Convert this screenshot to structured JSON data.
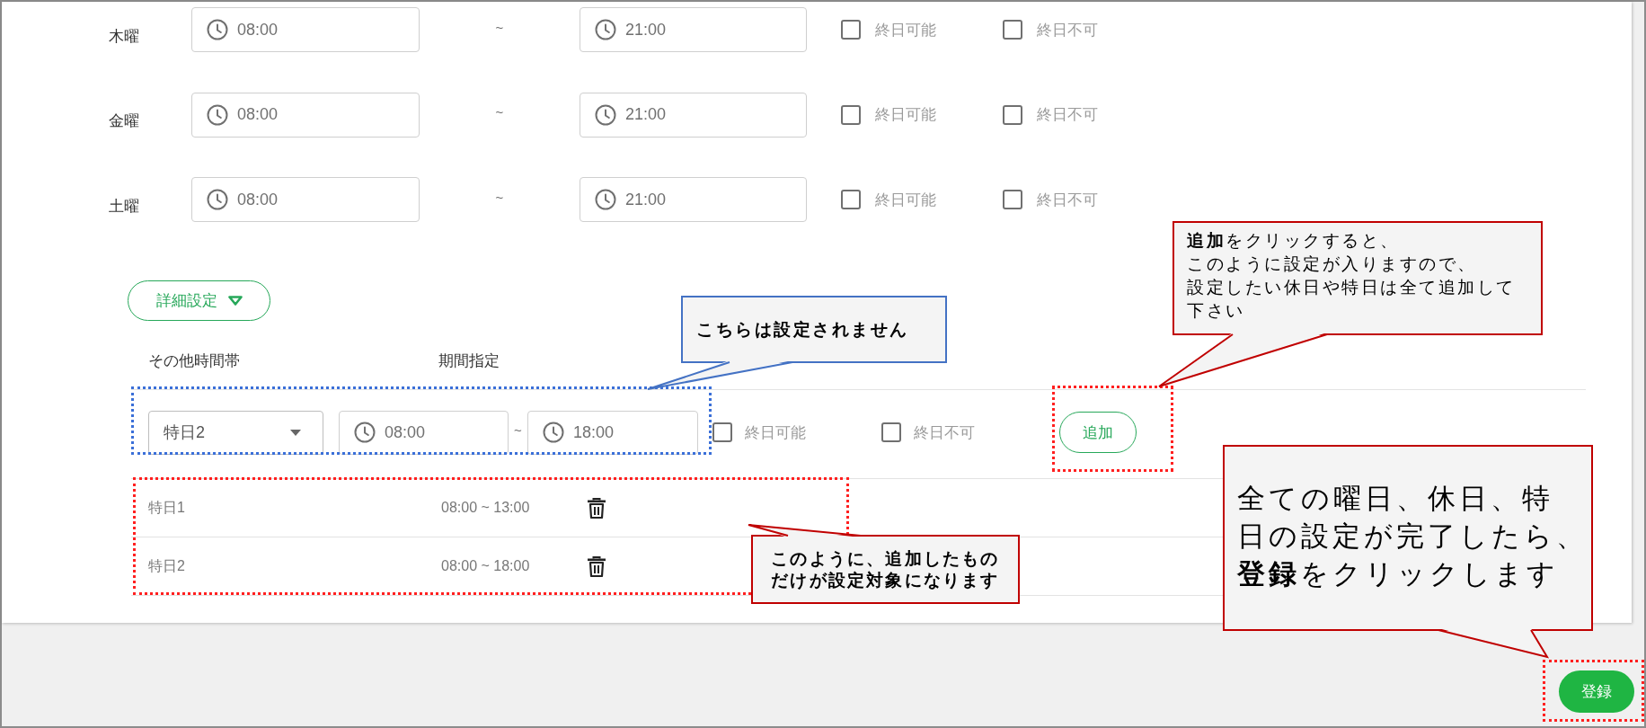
{
  "weekdays": [
    {
      "day": "木曜",
      "start": "08:00",
      "separator": "~",
      "end": "21:00",
      "options": [
        {
          "label": "終日可能",
          "checked": false
        },
        {
          "label": "終日不可",
          "checked": false
        }
      ]
    },
    {
      "day": "金曜",
      "start": "08:00",
      "separator": "~",
      "end": "21:00",
      "options": [
        {
          "label": "終日可能",
          "checked": false
        },
        {
          "label": "終日不可",
          "checked": false
        }
      ]
    },
    {
      "day": "土曜",
      "start": "08:00",
      "separator": "~",
      "end": "21:00",
      "options": [
        {
          "label": "終日可能",
          "checked": false
        },
        {
          "label": "終日不可",
          "checked": false
        }
      ]
    }
  ],
  "details_button": {
    "label": "詳細設定"
  },
  "other_hours": {
    "columns": [
      "その他時間帯",
      "期間指定"
    ],
    "entry": {
      "day_type": "特日2",
      "start": "08:00",
      "separator": "~",
      "end": "18:00",
      "options": [
        {
          "label": "終日可能",
          "checked": false
        },
        {
          "label": "終日不可",
          "checked": false
        }
      ],
      "add_button": "追加"
    },
    "rows": [
      {
        "day_type": "特日1",
        "period": "08:00 ~ 13:00"
      },
      {
        "day_type": "特日2",
        "period": "08:00 ~ 18:00"
      }
    ]
  },
  "register_button": {
    "label": "登録"
  },
  "callouts": [
    {
      "lines": [
        "**追加**をクリックすると、",
        "このように設定が入りますので、",
        "設定したい休日や特日は全て追加して",
        "下さい"
      ],
      "color": "#c00000"
    },
    {
      "lines": [
        "こちらは設定されません"
      ],
      "color": "#4472c4"
    },
    {
      "lines": [
        "このように、追加したもの",
        "だけが設定対象になります"
      ],
      "color": "#c00000"
    },
    {
      "lines": [
        "全ての曜日、休日、特",
        "日の設定が完了したら、",
        "**登録**をクリックします"
      ],
      "color": "#c00000"
    }
  ]
}
